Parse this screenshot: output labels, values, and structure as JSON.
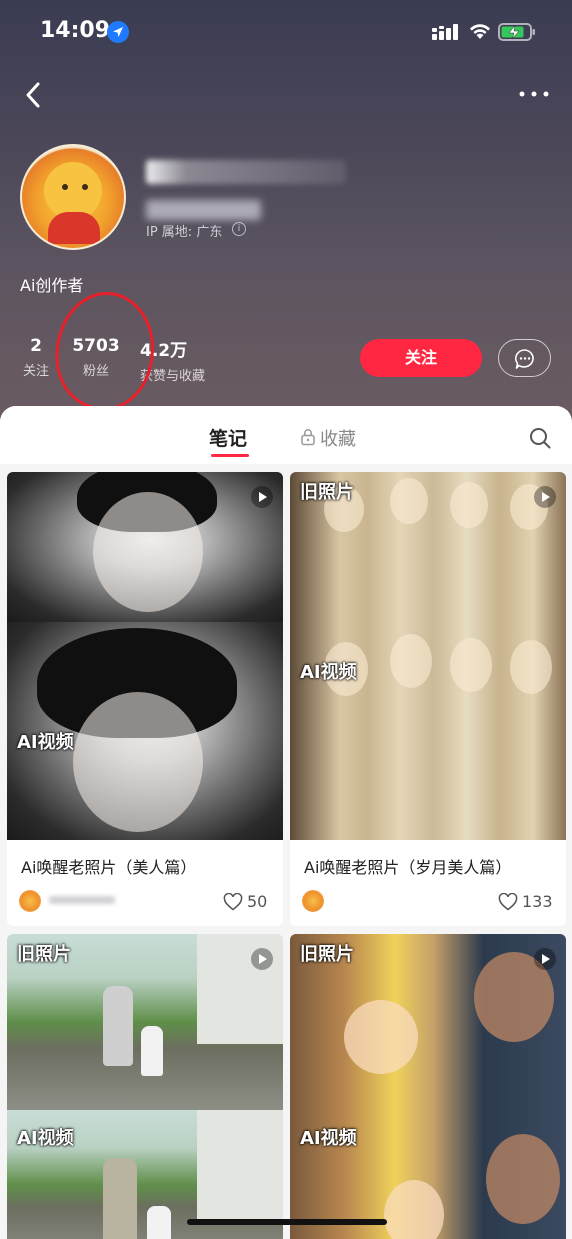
{
  "status_bar": {
    "time": "14:09"
  },
  "profile": {
    "ip_location": "IP 属地: 广东",
    "bio": "Ai创作者",
    "stats": [
      {
        "value": "2",
        "label": "关注"
      },
      {
        "value": "5703",
        "label": "粉丝"
      },
      {
        "value": "4.2万",
        "label": "获赞与收藏"
      }
    ],
    "follow_label": "关注"
  },
  "tabs": {
    "notes": "笔记",
    "collections": "收藏"
  },
  "cards": [
    {
      "tag_top": "",
      "tag_bottom": "AI视频",
      "title": "Ai唤醒老照片（美人篇）",
      "likes": "50"
    },
    {
      "tag_top": "旧照片",
      "tag_bottom": "AI视频",
      "title": "Ai唤醒老照片（岁月美人篇）",
      "likes": "133"
    },
    {
      "tag_top": "旧照片",
      "tag_bottom": "AI视频"
    },
    {
      "tag_top": "旧照片",
      "tag_bottom": "AI视频"
    }
  ],
  "colors": {
    "accent": "#ff2742",
    "annotation": "#e8202a",
    "header_top": "#3a3c52",
    "header_bottom": "#6c5c62"
  },
  "icons": [
    "location-arrow-icon",
    "signal-icon",
    "wifi-icon",
    "battery-charging-icon",
    "back-icon",
    "more-icon",
    "info-icon",
    "chat-icon",
    "lock-icon",
    "search-icon",
    "play-icon",
    "heart-icon"
  ]
}
